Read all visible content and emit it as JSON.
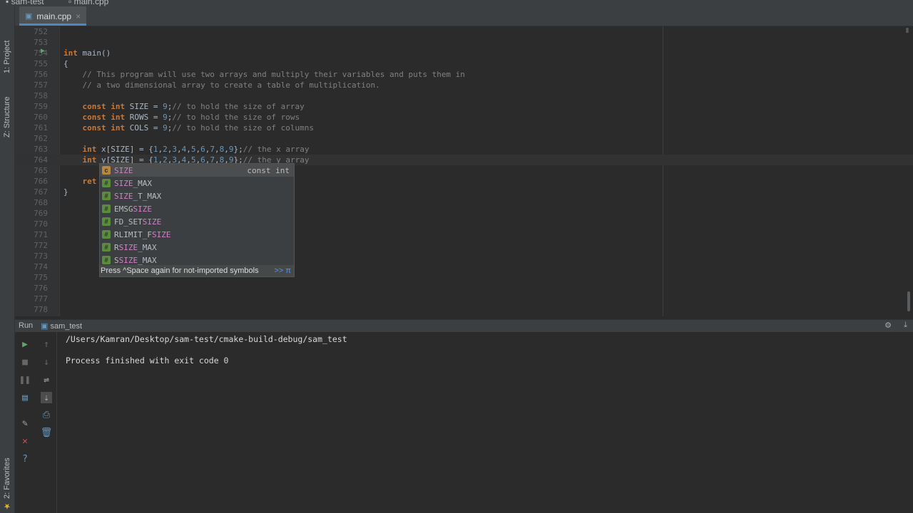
{
  "breadcrumb": {
    "project": "sam-test",
    "file": "main.cpp"
  },
  "tab": {
    "label": "main.cpp",
    "close": "×"
  },
  "left_tool_tabs": {
    "project": "1: Project",
    "structure": "Z: Structure",
    "favorites": "2: Favorites"
  },
  "editor": {
    "lines": [
      {
        "n": "752",
        "code": ""
      },
      {
        "n": "753",
        "code": ""
      },
      {
        "n": "754",
        "code": "int main()"
      },
      {
        "n": "755",
        "code": "{"
      },
      {
        "n": "756",
        "code": "    // This program will use two arrays and multiply their variables and puts them in"
      },
      {
        "n": "757",
        "code": "    // a two dimensional array to create a table of multiplication."
      },
      {
        "n": "758",
        "code": ""
      },
      {
        "n": "759",
        "code": "    const int SIZE = 9;// to hold the size of array"
      },
      {
        "n": "760",
        "code": "    const int ROWS = 9;// to hold the size of rows"
      },
      {
        "n": "761",
        "code": "    const int COLS = 9;// to hold the size of columns"
      },
      {
        "n": "762",
        "code": ""
      },
      {
        "n": "763",
        "code": "    int x[SIZE] = {1,2,3,4,5,6,7,8,9};// the x array"
      },
      {
        "n": "764",
        "code": "    int y[SIZE] = {1,2,3,4,5,6,7,8,9};// the y array"
      },
      {
        "n": "765",
        "code": ""
      },
      {
        "n": "766",
        "code": "    ret"
      },
      {
        "n": "767",
        "code": "}"
      },
      {
        "n": "768",
        "code": ""
      },
      {
        "n": "769",
        "code": ""
      },
      {
        "n": "770",
        "code": ""
      },
      {
        "n": "771",
        "code": ""
      },
      {
        "n": "772",
        "code": ""
      },
      {
        "n": "773",
        "code": ""
      },
      {
        "n": "774",
        "code": ""
      },
      {
        "n": "775",
        "code": ""
      },
      {
        "n": "776",
        "code": ""
      },
      {
        "n": "777",
        "code": ""
      },
      {
        "n": "778",
        "code": ""
      }
    ]
  },
  "completion": {
    "items": [
      {
        "pre": "",
        "hl": "SIZE",
        "post": "",
        "icon": "const-icon",
        "type": "const int"
      },
      {
        "pre": "",
        "hl": "SIZE",
        "post": "_MAX",
        "icon": "define-icon",
        "type": ""
      },
      {
        "pre": "",
        "hl": "SIZE",
        "post": "_T_MAX",
        "icon": "define-icon",
        "type": ""
      },
      {
        "pre": "EMSG",
        "hl": "SIZE",
        "post": "",
        "icon": "define-icon",
        "type": ""
      },
      {
        "pre": "FD_SET",
        "hl": "SIZE",
        "post": "",
        "icon": "define-icon",
        "type": ""
      },
      {
        "pre": "RLIMIT_F",
        "hl": "SIZE",
        "post": "",
        "icon": "define-icon",
        "type": ""
      },
      {
        "pre": "R",
        "hl": "SIZE",
        "post": "_MAX",
        "icon": "define-icon",
        "type": ""
      },
      {
        "pre": "S",
        "hl": "SIZE",
        "post": "_MAX",
        "icon": "define-icon",
        "type": ""
      }
    ],
    "hint": "Press ^Space again for not-imported symbols",
    "hint_link": ">> π"
  },
  "run_panel": {
    "label": "Run",
    "config": "sam_test",
    "output": [
      "/Users/Kamran/Desktop/sam-test/cmake-build-debug/sam_test",
      "",
      "Process finished with exit code 0"
    ]
  },
  "colors": {
    "accent": "#4a88c7",
    "keyword": "#cc7832",
    "comment": "#808080",
    "number": "#6897bb",
    "match": "#d27fc8"
  }
}
